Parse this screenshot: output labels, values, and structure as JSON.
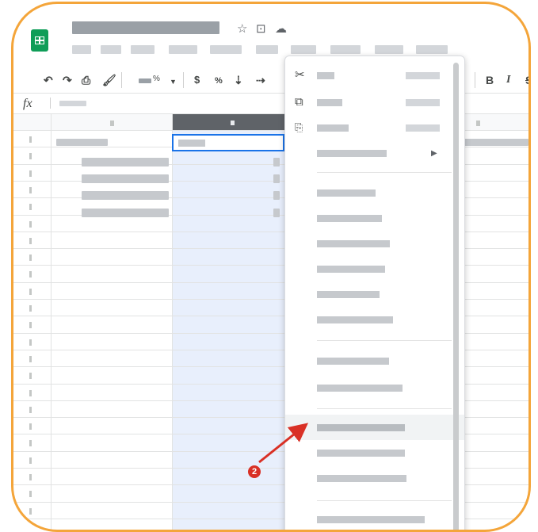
{
  "app": {
    "name": "Google Sheets",
    "logo_color": "#0f9d58",
    "title_icons": [
      "star-icon",
      "move-to-folder-icon",
      "cloud-saved-icon"
    ]
  },
  "toolbar": {
    "format_currency": "$",
    "format_percent": "%",
    "zoom_suffix": "%",
    "bold": "B",
    "italic": "I"
  },
  "formula_bar": {
    "fx_label": "fx"
  },
  "sheet": {
    "selected_column_color": "#e8effc",
    "selected_header_color": "#5f6368",
    "selection_border_color": "#1a73e8"
  },
  "context_menu": {
    "items": [
      {
        "icon": "cut-icon",
        "glyph": "✂"
      },
      {
        "icon": "copy-icon",
        "glyph": "⧉"
      },
      {
        "icon": "paste-icon",
        "glyph": "📋"
      },
      {
        "icon": "submenu-arrow-icon",
        "glyph": "▶"
      }
    ]
  },
  "annotation": {
    "step": "2",
    "color": "#d93025"
  },
  "frame": {
    "border_color": "#f4a53a"
  }
}
